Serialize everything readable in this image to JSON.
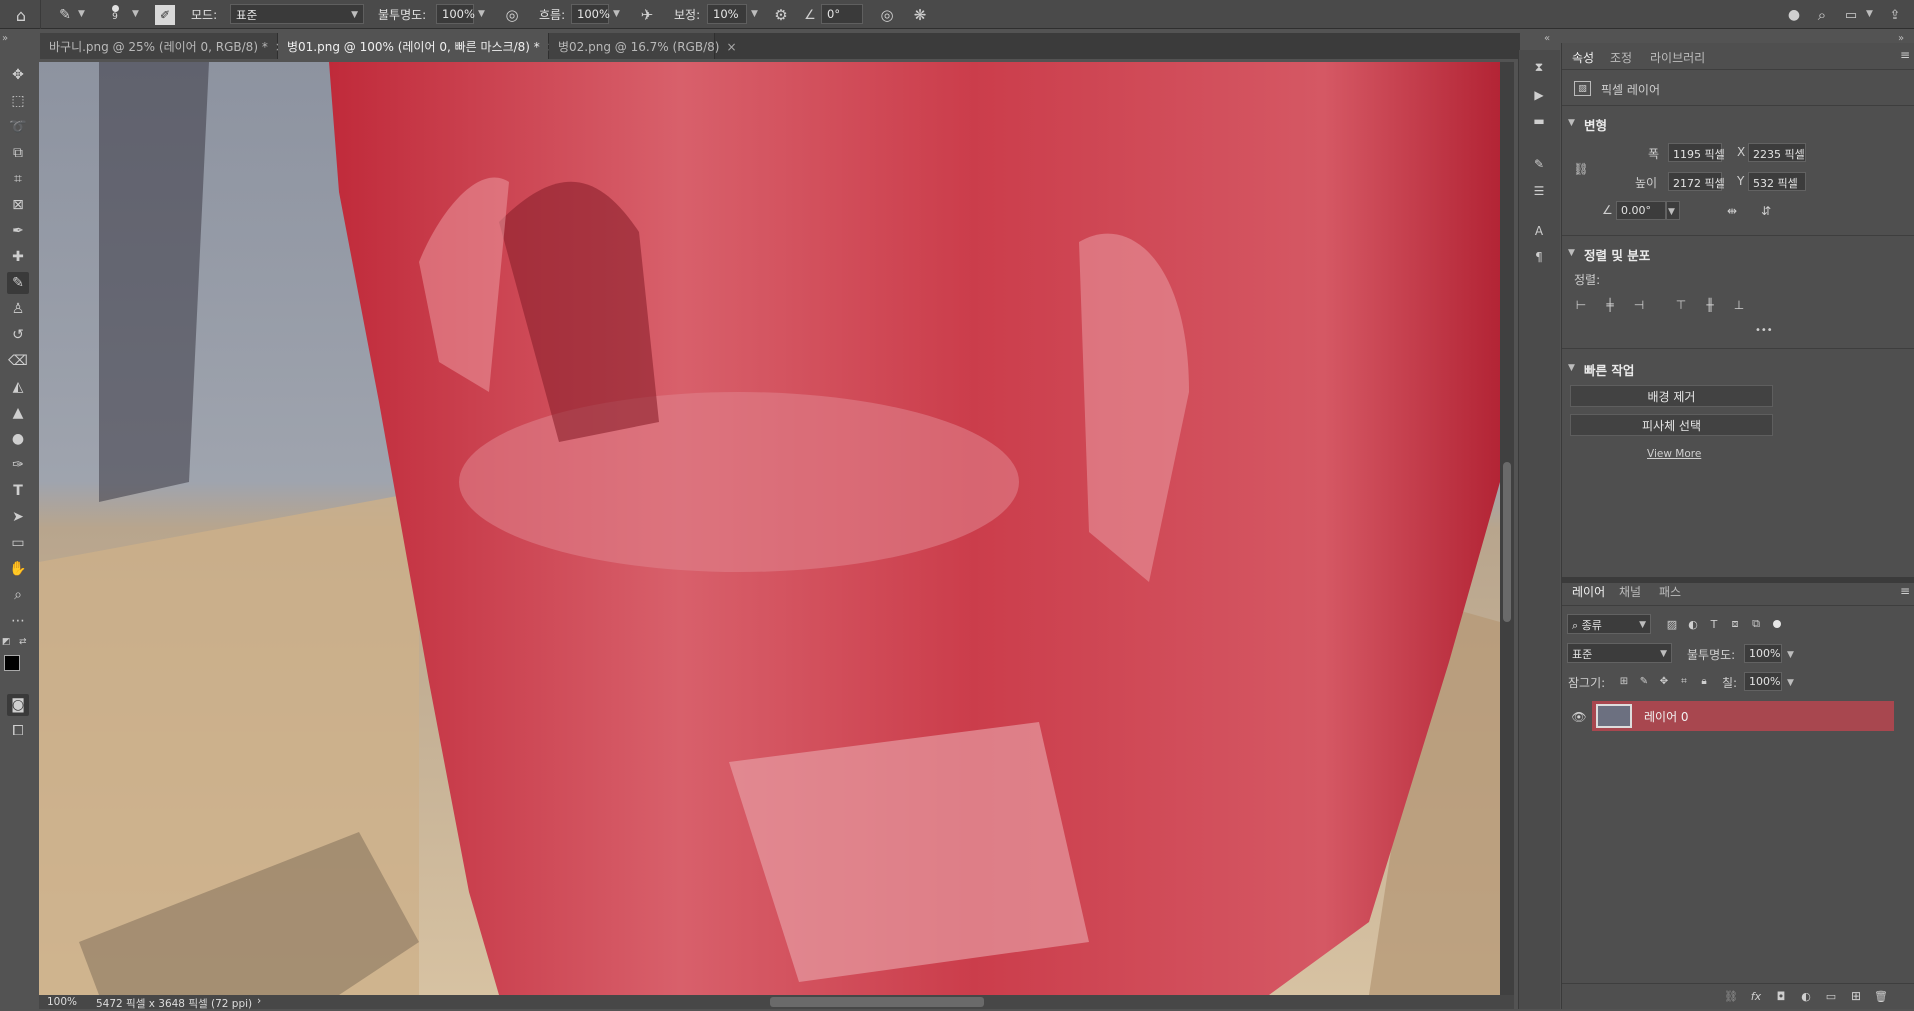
{
  "options_bar": {
    "mode_label": "모드:",
    "mode_value": "표준",
    "opacity_label": "불투명도:",
    "opacity_value": "100%",
    "flow_label": "흐름:",
    "flow_value": "100%",
    "smoothing_label": "보정:",
    "smoothing_value": "10%",
    "angle_value": "0°",
    "brush_size": "9"
  },
  "tabs": [
    {
      "label": "바구니.png @ 25% (레이어 0, RGB/8) *",
      "close": "×"
    },
    {
      "label": "병01.png @ 100% (레이어 0, 빠른 마스크/8) *",
      "close": "×"
    },
    {
      "label": "병02.png @ 16.7% (RGB/8)",
      "close": "×"
    }
  ],
  "status": {
    "zoom": "100%",
    "doc_info": "5472 픽셀 x 3648 픽셀 (72 ppi)",
    "arrow": "›"
  },
  "properties": {
    "tabs": [
      "속성",
      "조정",
      "라이브러리"
    ],
    "layer_type": "픽셀 레이어",
    "transform": {
      "title": "변형",
      "w_label": "폭",
      "w_value": "1195 픽셀",
      "x_label": "X",
      "x_value": "2235 픽셀",
      "h_label": "높이",
      "h_value": "2172 픽셀",
      "y_label": "Y",
      "y_value": "532 픽셀",
      "angle_value": "0.00°"
    },
    "align": {
      "title": "정렬 및 분포",
      "sub": "정렬:",
      "more": "•••"
    },
    "quick_actions": {
      "title": "빠른 작업",
      "remove_bg": "배경 제거",
      "select_subject": "피사체 선택",
      "view_more": "View More"
    }
  },
  "layers": {
    "tabs": [
      "레이어",
      "채널",
      "패스"
    ],
    "filter_label": "종류",
    "blend_mode": "표준",
    "opacity_label": "불투명도:",
    "opacity_value": "100%",
    "lock_label": "잠그기:",
    "fill_label": "칠:",
    "fill_value": "100%",
    "items": [
      {
        "name": "레이어 0"
      }
    ]
  },
  "colors": {
    "accent_selected_layer": "#a8474f",
    "quick_mask_overlay": "#c8323f"
  }
}
